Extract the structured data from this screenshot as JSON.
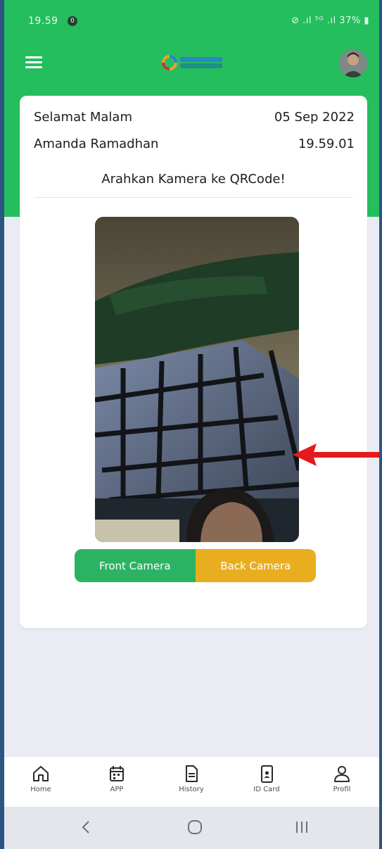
{
  "status_bar": {
    "time": "19.59",
    "notification_count": "0",
    "right_text": "⊘ .ıl ⁵ᴳ .ıl 37% ▮"
  },
  "app_bar": {
    "menu_icon": "hamburger-menu-icon",
    "logo_icon": "app-logo",
    "avatar_icon": "user-avatar"
  },
  "card": {
    "greeting": "Selamat Malam",
    "date": "05 Sep 2022",
    "user_name": "Amanda Ramadhan",
    "time": "19.59.01",
    "instruction": "Arahkan Kamera ke QRCode!"
  },
  "camera_toggle": {
    "front_label": "Front Camera",
    "back_label": "Back Camera",
    "front_color": "#2bb363",
    "back_color": "#e9ae1f"
  },
  "bottom_nav": {
    "items": [
      {
        "label": "Home",
        "icon": "home-icon"
      },
      {
        "label": "APP",
        "icon": "calendar-icon"
      },
      {
        "label": "History",
        "icon": "document-icon"
      },
      {
        "label": "ID Card",
        "icon": "id-card-icon"
      },
      {
        "label": "Profil",
        "icon": "profile-icon"
      }
    ]
  },
  "system_nav": {
    "back_icon": "back-icon",
    "home_icon": "home-circle-icon",
    "recents_icon": "recents-icon"
  },
  "colors": {
    "header_green": "#25be5e",
    "background": "#e9edf3",
    "arrow_red": "#e31b1b"
  }
}
